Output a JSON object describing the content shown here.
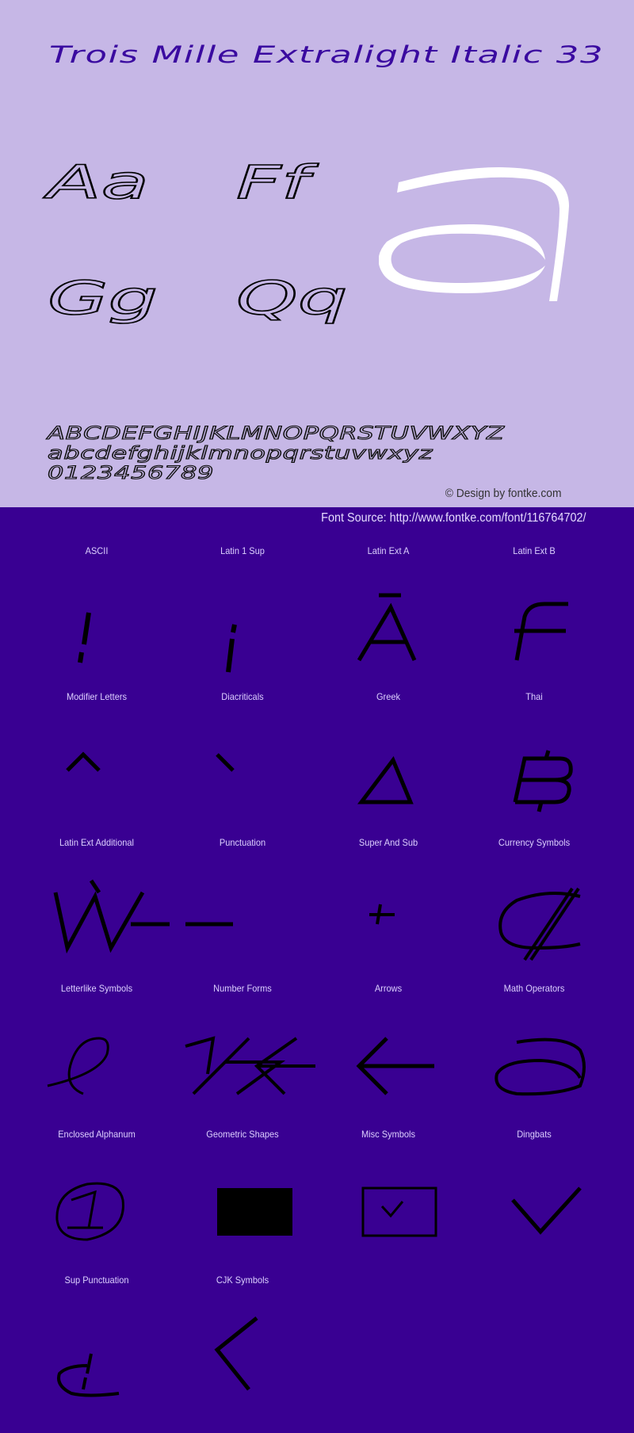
{
  "header": {
    "title": "Trois Mille Extralight Italic 33",
    "pairs": [
      "Aa",
      "Ff",
      "Gg",
      "Qq"
    ],
    "big_glyph": "a",
    "uppercase": "ABCDEFGHIJKLMNOPQRSTUVWXYZ",
    "lowercase": "abcdefghijklmnopqrstuvwxyz",
    "digits": "0123456789",
    "credit": "© Design by fontke.com"
  },
  "source": "Font Source: http://www.fontke.com/font/116764702/",
  "colors": {
    "top_background": "#c6b7e6",
    "bottom_background": "#390092",
    "title_color": "#3a0aa0",
    "big_glyph_color": "#ffffff",
    "glyph_color": "#000000"
  },
  "categories": [
    {
      "label": "ASCII",
      "glyph": "!"
    },
    {
      "label": "Latin 1 Sup",
      "glyph": "¡"
    },
    {
      "label": "Latin Ext A",
      "glyph": "Ā"
    },
    {
      "label": "Latin Ext B",
      "glyph": "ƒ"
    },
    {
      "label": "Modifier Letters",
      "glyph": "ˆ"
    },
    {
      "label": "Diacriticals",
      "glyph": "̀"
    },
    {
      "label": "Greek",
      "glyph": "Δ"
    },
    {
      "label": "Thai",
      "glyph": "฿"
    },
    {
      "label": "Latin Ext Additional",
      "glyph": "Ẁ"
    },
    {
      "label": "Punctuation",
      "glyph": "—"
    },
    {
      "label": "Super And Sub",
      "glyph": "⁺"
    },
    {
      "label": "Currency Symbols",
      "glyph": "₡"
    },
    {
      "label": "Letterlike Symbols",
      "glyph": "ℓ"
    },
    {
      "label": "Number Forms",
      "glyph": "⅐"
    },
    {
      "label": "Arrows",
      "glyph": "←"
    },
    {
      "label": "Math Operators",
      "glyph": "∂"
    },
    {
      "label": "Enclosed Alphanum",
      "glyph": "①"
    },
    {
      "label": "Geometric Shapes",
      "glyph": "■"
    },
    {
      "label": "Misc Symbols",
      "glyph": "☑"
    },
    {
      "label": "Dingbats",
      "glyph": "✓"
    },
    {
      "label": "Sup Punctuation",
      "glyph": "⸘"
    },
    {
      "label": "CJK Symbols",
      "glyph": "〈"
    }
  ]
}
